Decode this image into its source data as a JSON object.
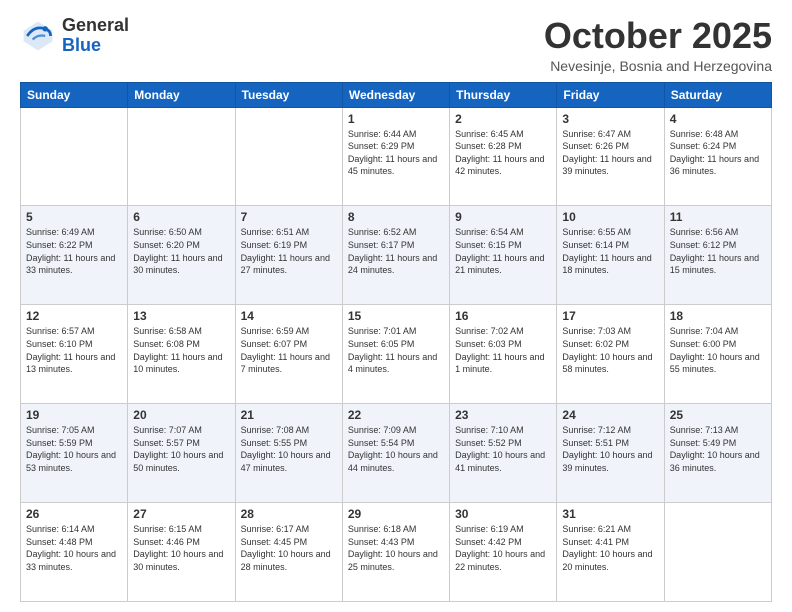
{
  "header": {
    "logo_general": "General",
    "logo_blue": "Blue",
    "month": "October 2025",
    "location": "Nevesinje, Bosnia and Herzegovina"
  },
  "weekdays": [
    "Sunday",
    "Monday",
    "Tuesday",
    "Wednesday",
    "Thursday",
    "Friday",
    "Saturday"
  ],
  "weeks": [
    [
      {
        "day": "",
        "sunrise": "",
        "sunset": "",
        "daylight": ""
      },
      {
        "day": "",
        "sunrise": "",
        "sunset": "",
        "daylight": ""
      },
      {
        "day": "",
        "sunrise": "",
        "sunset": "",
        "daylight": ""
      },
      {
        "day": "1",
        "sunrise": "Sunrise: 6:44 AM",
        "sunset": "Sunset: 6:29 PM",
        "daylight": "Daylight: 11 hours and 45 minutes."
      },
      {
        "day": "2",
        "sunrise": "Sunrise: 6:45 AM",
        "sunset": "Sunset: 6:28 PM",
        "daylight": "Daylight: 11 hours and 42 minutes."
      },
      {
        "day": "3",
        "sunrise": "Sunrise: 6:47 AM",
        "sunset": "Sunset: 6:26 PM",
        "daylight": "Daylight: 11 hours and 39 minutes."
      },
      {
        "day": "4",
        "sunrise": "Sunrise: 6:48 AM",
        "sunset": "Sunset: 6:24 PM",
        "daylight": "Daylight: 11 hours and 36 minutes."
      }
    ],
    [
      {
        "day": "5",
        "sunrise": "Sunrise: 6:49 AM",
        "sunset": "Sunset: 6:22 PM",
        "daylight": "Daylight: 11 hours and 33 minutes."
      },
      {
        "day": "6",
        "sunrise": "Sunrise: 6:50 AM",
        "sunset": "Sunset: 6:20 PM",
        "daylight": "Daylight: 11 hours and 30 minutes."
      },
      {
        "day": "7",
        "sunrise": "Sunrise: 6:51 AM",
        "sunset": "Sunset: 6:19 PM",
        "daylight": "Daylight: 11 hours and 27 minutes."
      },
      {
        "day": "8",
        "sunrise": "Sunrise: 6:52 AM",
        "sunset": "Sunset: 6:17 PM",
        "daylight": "Daylight: 11 hours and 24 minutes."
      },
      {
        "day": "9",
        "sunrise": "Sunrise: 6:54 AM",
        "sunset": "Sunset: 6:15 PM",
        "daylight": "Daylight: 11 hours and 21 minutes."
      },
      {
        "day": "10",
        "sunrise": "Sunrise: 6:55 AM",
        "sunset": "Sunset: 6:14 PM",
        "daylight": "Daylight: 11 hours and 18 minutes."
      },
      {
        "day": "11",
        "sunrise": "Sunrise: 6:56 AM",
        "sunset": "Sunset: 6:12 PM",
        "daylight": "Daylight: 11 hours and 15 minutes."
      }
    ],
    [
      {
        "day": "12",
        "sunrise": "Sunrise: 6:57 AM",
        "sunset": "Sunset: 6:10 PM",
        "daylight": "Daylight: 11 hours and 13 minutes."
      },
      {
        "day": "13",
        "sunrise": "Sunrise: 6:58 AM",
        "sunset": "Sunset: 6:08 PM",
        "daylight": "Daylight: 11 hours and 10 minutes."
      },
      {
        "day": "14",
        "sunrise": "Sunrise: 6:59 AM",
        "sunset": "Sunset: 6:07 PM",
        "daylight": "Daylight: 11 hours and 7 minutes."
      },
      {
        "day": "15",
        "sunrise": "Sunrise: 7:01 AM",
        "sunset": "Sunset: 6:05 PM",
        "daylight": "Daylight: 11 hours and 4 minutes."
      },
      {
        "day": "16",
        "sunrise": "Sunrise: 7:02 AM",
        "sunset": "Sunset: 6:03 PM",
        "daylight": "Daylight: 11 hours and 1 minute."
      },
      {
        "day": "17",
        "sunrise": "Sunrise: 7:03 AM",
        "sunset": "Sunset: 6:02 PM",
        "daylight": "Daylight: 10 hours and 58 minutes."
      },
      {
        "day": "18",
        "sunrise": "Sunrise: 7:04 AM",
        "sunset": "Sunset: 6:00 PM",
        "daylight": "Daylight: 10 hours and 55 minutes."
      }
    ],
    [
      {
        "day": "19",
        "sunrise": "Sunrise: 7:05 AM",
        "sunset": "Sunset: 5:59 PM",
        "daylight": "Daylight: 10 hours and 53 minutes."
      },
      {
        "day": "20",
        "sunrise": "Sunrise: 7:07 AM",
        "sunset": "Sunset: 5:57 PM",
        "daylight": "Daylight: 10 hours and 50 minutes."
      },
      {
        "day": "21",
        "sunrise": "Sunrise: 7:08 AM",
        "sunset": "Sunset: 5:55 PM",
        "daylight": "Daylight: 10 hours and 47 minutes."
      },
      {
        "day": "22",
        "sunrise": "Sunrise: 7:09 AM",
        "sunset": "Sunset: 5:54 PM",
        "daylight": "Daylight: 10 hours and 44 minutes."
      },
      {
        "day": "23",
        "sunrise": "Sunrise: 7:10 AM",
        "sunset": "Sunset: 5:52 PM",
        "daylight": "Daylight: 10 hours and 41 minutes."
      },
      {
        "day": "24",
        "sunrise": "Sunrise: 7:12 AM",
        "sunset": "Sunset: 5:51 PM",
        "daylight": "Daylight: 10 hours and 39 minutes."
      },
      {
        "day": "25",
        "sunrise": "Sunrise: 7:13 AM",
        "sunset": "Sunset: 5:49 PM",
        "daylight": "Daylight: 10 hours and 36 minutes."
      }
    ],
    [
      {
        "day": "26",
        "sunrise": "Sunrise: 6:14 AM",
        "sunset": "Sunset: 4:48 PM",
        "daylight": "Daylight: 10 hours and 33 minutes."
      },
      {
        "day": "27",
        "sunrise": "Sunrise: 6:15 AM",
        "sunset": "Sunset: 4:46 PM",
        "daylight": "Daylight: 10 hours and 30 minutes."
      },
      {
        "day": "28",
        "sunrise": "Sunrise: 6:17 AM",
        "sunset": "Sunset: 4:45 PM",
        "daylight": "Daylight: 10 hours and 28 minutes."
      },
      {
        "day": "29",
        "sunrise": "Sunrise: 6:18 AM",
        "sunset": "Sunset: 4:43 PM",
        "daylight": "Daylight: 10 hours and 25 minutes."
      },
      {
        "day": "30",
        "sunrise": "Sunrise: 6:19 AM",
        "sunset": "Sunset: 4:42 PM",
        "daylight": "Daylight: 10 hours and 22 minutes."
      },
      {
        "day": "31",
        "sunrise": "Sunrise: 6:21 AM",
        "sunset": "Sunset: 4:41 PM",
        "daylight": "Daylight: 10 hours and 20 minutes."
      },
      {
        "day": "",
        "sunrise": "",
        "sunset": "",
        "daylight": ""
      }
    ]
  ]
}
